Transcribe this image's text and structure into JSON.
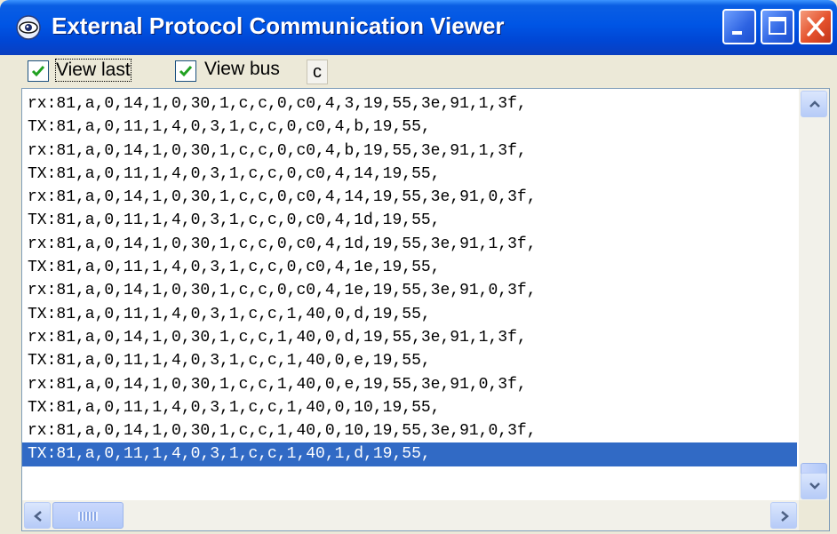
{
  "window": {
    "title": "External Protocol Communication Viewer",
    "app_icon": "eye-icon"
  },
  "title_buttons": [
    "minimize-icon",
    "maximize-icon",
    "close-icon"
  ],
  "toolbar": {
    "view_last": {
      "label": "View last",
      "checked": true
    },
    "view_bus": {
      "label": "View bus",
      "checked": true
    },
    "c_button_label": "c"
  },
  "log": {
    "lines": [
      "rx:81,a,0,14,1,0,30,1,c,c,0,c0,4,3,19,55,3e,91,1,3f,",
      "TX:81,a,0,11,1,4,0,3,1,c,c,0,c0,4,b,19,55,",
      "rx:81,a,0,14,1,0,30,1,c,c,0,c0,4,b,19,55,3e,91,1,3f,",
      "TX:81,a,0,11,1,4,0,3,1,c,c,0,c0,4,14,19,55,",
      "rx:81,a,0,14,1,0,30,1,c,c,0,c0,4,14,19,55,3e,91,0,3f,",
      "TX:81,a,0,11,1,4,0,3,1,c,c,0,c0,4,1d,19,55,",
      "rx:81,a,0,14,1,0,30,1,c,c,0,c0,4,1d,19,55,3e,91,1,3f,",
      "TX:81,a,0,11,1,4,0,3,1,c,c,0,c0,4,1e,19,55,",
      "rx:81,a,0,14,1,0,30,1,c,c,0,c0,4,1e,19,55,3e,91,0,3f,",
      "TX:81,a,0,11,1,4,0,3,1,c,c,1,40,0,d,19,55,",
      "rx:81,a,0,14,1,0,30,1,c,c,1,40,0,d,19,55,3e,91,1,3f,",
      "TX:81,a,0,11,1,4,0,3,1,c,c,1,40,0,e,19,55,",
      "rx:81,a,0,14,1,0,30,1,c,c,1,40,0,e,19,55,3e,91,0,3f,",
      "TX:81,a,0,11,1,4,0,3,1,c,c,1,40,0,10,19,55,",
      "rx:81,a,0,14,1,0,30,1,c,c,1,40,0,10,19,55,3e,91,0,3f,",
      "TX:81,a,0,11,1,4,0,3,1,c,c,1,40,1,d,19,55,"
    ],
    "selected_index": 15
  },
  "colors": {
    "titlebar": "#0055e5",
    "selection": "#316ac5",
    "close_button": "#e4512c"
  }
}
